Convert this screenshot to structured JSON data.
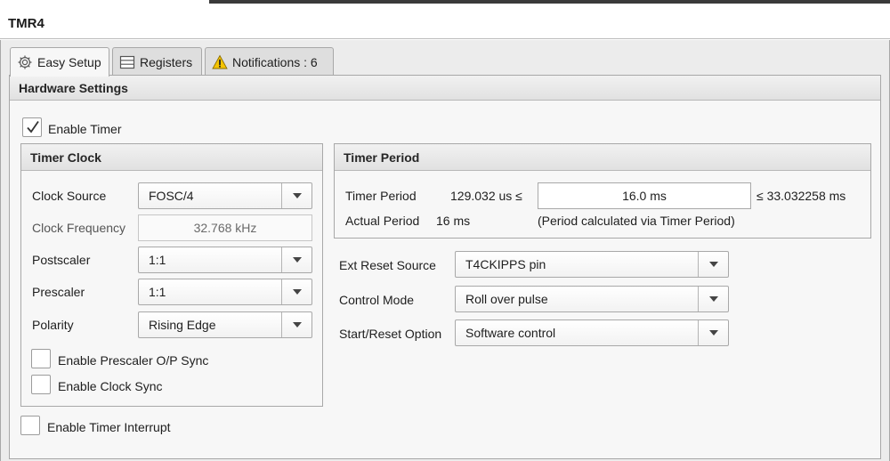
{
  "window": {
    "title": "TMR4"
  },
  "tabs": [
    {
      "label": "Easy Setup",
      "icon": "gear-icon"
    },
    {
      "label": "Registers",
      "icon": "list-icon"
    },
    {
      "label": "Notifications : 6",
      "icon": "warning-icon"
    }
  ],
  "hardware": {
    "header": "Hardware Settings",
    "enable_timer": {
      "label": "Enable Timer",
      "checked": true
    },
    "enable_interrupt": {
      "label": "Enable Timer Interrupt",
      "checked": false
    }
  },
  "timer_clock": {
    "header": "Timer Clock",
    "clock_source": {
      "label": "Clock Source",
      "value": "FOSC/4"
    },
    "clock_frequency": {
      "label": "Clock Frequency",
      "value": "32.768 kHz"
    },
    "postscaler": {
      "label": "Postscaler",
      "value": "1:1"
    },
    "prescaler": {
      "label": "Prescaler",
      "value": "1:1"
    },
    "polarity": {
      "label": "Polarity",
      "value": "Rising Edge"
    },
    "prescaler_sync": {
      "label": "Enable Prescaler O/P Sync",
      "checked": false
    },
    "clock_sync": {
      "label": "Enable Clock Sync",
      "checked": false
    }
  },
  "timer_period": {
    "header": "Timer Period",
    "period_label": "Timer Period",
    "min_value": "129.032 us ≤",
    "period_value": "16.0 ms",
    "max_value": "≤ 33.032258 ms",
    "actual_label": "Actual Period",
    "actual_value": "16 ms",
    "note": "(Period calculated via Timer Period)"
  },
  "reset": {
    "ext_reset_source": {
      "label": "Ext Reset Source",
      "value": "T4CKIPPS pin"
    },
    "control_mode": {
      "label": "Control Mode",
      "value": "Roll over pulse"
    },
    "start_reset_option": {
      "label": "Start/Reset Option",
      "value": "Software control"
    }
  },
  "colors": {
    "warning": "#f5c400",
    "panel": "#ececec",
    "border": "#a8a8a8"
  }
}
